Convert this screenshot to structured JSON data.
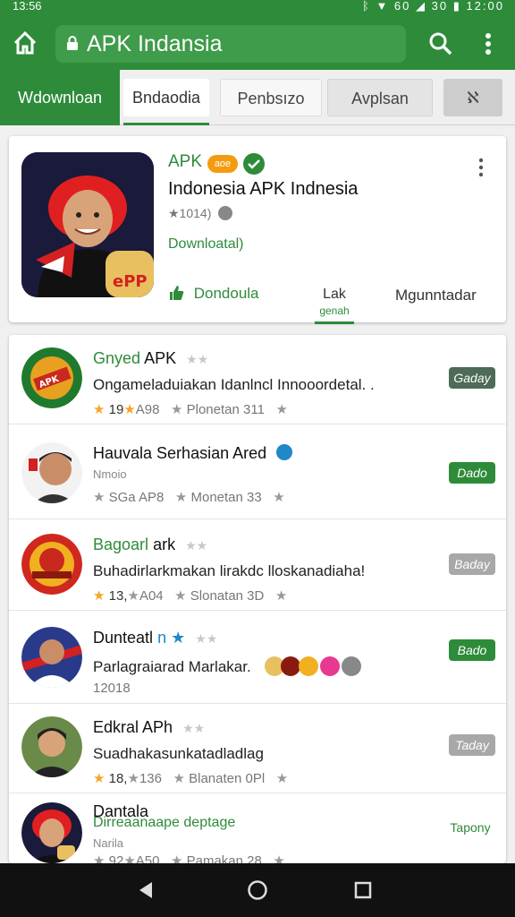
{
  "status": {
    "time": "13:56",
    "right": "ᛒ ▼ 60 ◢ 30 ▮ 12:00"
  },
  "toolbar": {
    "url": "APK Indansia"
  },
  "tabs": [
    "Wdownloan",
    "Bndaodia",
    "Penbsızo",
    "Avplsan",
    "ℵ"
  ],
  "app": {
    "tag": "APK",
    "badge": "aoe",
    "title": "Indonesia APK Indnesia",
    "rating": "★1014)",
    "download_link": "Downloatal)",
    "download_button": "Dondoula",
    "sub_tab_label": "Lak",
    "sub_tab_sub": "genah",
    "more_button": "Mgunntadar"
  },
  "rows": [
    {
      "title": "Gnyed",
      "title2": "APK",
      "desc": "Ongameladuiakan Idanlncl Innooordetal. .",
      "rating": "19",
      "rating2": "A98",
      "location": "Plonetan 311",
      "chip": "Gaday",
      "chip_color": "#4d6b58"
    },
    {
      "title": "Hauvala Serhasian Ared",
      "sub": "Nmoio",
      "desc": "",
      "rating": "SGa",
      "rating2": "AP8",
      "location": "Monetan 33",
      "chip": "Dado",
      "chip_color": "#2e8b3a"
    },
    {
      "title": "Bagoarl",
      "title2": "ark",
      "desc": "Buhadirlarkmakan lirakdc lloskanadiaha!",
      "rating": "13,",
      "rating2": "A04",
      "location": "Slonatan 3D",
      "chip": "Baday",
      "chip_color": "#a8a8a8"
    },
    {
      "title": "Dunteatl",
      "title2": "n",
      "desc": "Parlagraiarad Marlakar.",
      "sub2": "12018",
      "chip": "Bado",
      "chip_color": "#2e8b3a"
    },
    {
      "title": "Edkral APh",
      "desc": "Suadhakasunkatadladlag",
      "rating": "18,",
      "rating2": "136",
      "location": "Blanaten 0Pl",
      "chip": "Taday",
      "chip_color": "#a8a8a8"
    },
    {
      "title": "Dantala",
      "title_green": "Dirreaanaape deptage",
      "sub": "Narila",
      "rating": "92",
      "rating2": "A50",
      "location": "Pamakan 28",
      "chip": "Tapony",
      "chip_color": "transparent"
    }
  ]
}
